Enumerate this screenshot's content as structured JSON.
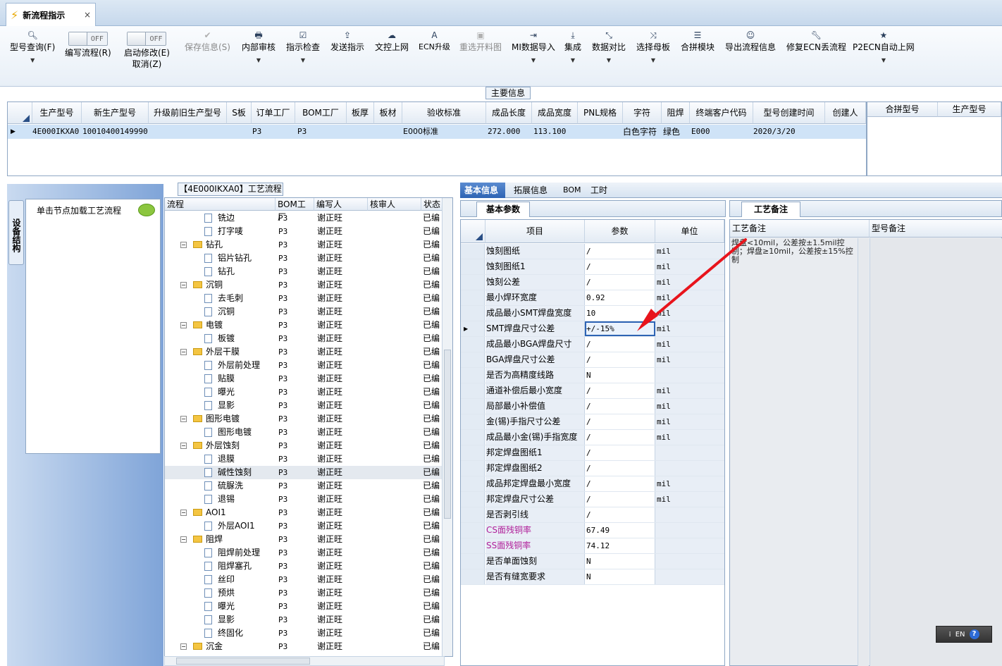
{
  "tab": {
    "title": "新流程指示",
    "close": "×"
  },
  "toolbar": {
    "query": "型号查询(F)",
    "write_flow": "编写流程(R)",
    "toggle_off": "OFF",
    "start_modify": "启动修改(E)",
    "cancel": "取消(Z)",
    "save_info": "保存信息(S)",
    "internal_review": "内部审核",
    "instruction_check": "指示检查",
    "send_instruction": "发送指示",
    "doc_online": "文控上网",
    "ecn_upgrade": "ECN升级",
    "reselect_panel": "重选开料图",
    "mi_import": "MI数据导入",
    "integrate": "集成",
    "data_compare": "数据对比",
    "select_mother": "选择母板",
    "merge_module": "合拼模块",
    "export_flow": "导出流程信息",
    "fix_ecn": "修复ECN丢流程",
    "p2ecn": "P2ECN自动上网"
  },
  "main_info": {
    "caption": "主要信息",
    "headers": [
      "生产型号",
      "新生产型号",
      "升级前旧生产型号",
      "S板",
      "订单工厂",
      "BOM工厂",
      "板厚",
      "板材",
      "验收标准",
      "成品长度",
      "成品宽度",
      "PNL规格",
      "字符",
      "阻焊",
      "终端客户代码",
      "型号创建时间",
      "创建人"
    ],
    "row": [
      "4E000IKXA0",
      "10010400149990",
      "",
      "",
      "P3",
      "P3",
      "",
      "",
      "E000标准",
      "272.000",
      "113.100",
      "",
      "白色字符",
      "绿色",
      "E000",
      "2020/3/20",
      ""
    ],
    "merge_headers": [
      "合拼型号",
      "生产型号"
    ]
  },
  "left_rail": {
    "tab": "设备结构",
    "hint": "单击节点加载工艺流程"
  },
  "process": {
    "title": "【4E000IKXA0】工艺流程",
    "headers": [
      "流程",
      "BOM工厂",
      "编写人",
      "核审人",
      "状态"
    ],
    "rows": [
      {
        "name": "铣边",
        "bom": "P3",
        "writer": "谢正旺",
        "status": "已编"
      },
      {
        "name": "打字唛",
        "bom": "P3",
        "writer": "谢正旺",
        "status": "已编"
      },
      {
        "name": "钻孔",
        "bom": "P3",
        "writer": "谢正旺",
        "status": "已编"
      },
      {
        "name": "铝片钻孔",
        "bom": "P3",
        "writer": "谢正旺",
        "status": "已编"
      },
      {
        "name": "钻孔",
        "bom": "P3",
        "writer": "谢正旺",
        "status": "已编"
      },
      {
        "name": "沉铜",
        "bom": "P3",
        "writer": "谢正旺",
        "status": "已编"
      },
      {
        "name": "去毛刺",
        "bom": "P3",
        "writer": "谢正旺",
        "status": "已编"
      },
      {
        "name": "沉铜",
        "bom": "P3",
        "writer": "谢正旺",
        "status": "已编"
      },
      {
        "name": "电镀",
        "bom": "P3",
        "writer": "谢正旺",
        "status": "已编"
      },
      {
        "name": "板镀",
        "bom": "P3",
        "writer": "谢正旺",
        "status": "已编"
      },
      {
        "name": "外层干膜",
        "bom": "P3",
        "writer": "谢正旺",
        "status": "已编"
      },
      {
        "name": "外层前处理",
        "bom": "P3",
        "writer": "谢正旺",
        "status": "已编"
      },
      {
        "name": "贴膜",
        "bom": "P3",
        "writer": "谢正旺",
        "status": "已编"
      },
      {
        "name": "曝光",
        "bom": "P3",
        "writer": "谢正旺",
        "status": "已编"
      },
      {
        "name": "显影",
        "bom": "P3",
        "writer": "谢正旺",
        "status": "已编"
      },
      {
        "name": "图形电镀",
        "bom": "P3",
        "writer": "谢正旺",
        "status": "已编"
      },
      {
        "name": "图形电镀",
        "bom": "P3",
        "writer": "谢正旺",
        "status": "已编"
      },
      {
        "name": "外层蚀刻",
        "bom": "P3",
        "writer": "谢正旺",
        "status": "已编"
      },
      {
        "name": "退膜",
        "bom": "P3",
        "writer": "谢正旺",
        "status": "已编"
      },
      {
        "name": "碱性蚀刻",
        "bom": "P3",
        "writer": "谢正旺",
        "status": "已编"
      },
      {
        "name": "硫脲洗",
        "bom": "P3",
        "writer": "谢正旺",
        "status": "已编"
      },
      {
        "name": "退锡",
        "bom": "P3",
        "writer": "谢正旺",
        "status": "已编"
      },
      {
        "name": "AOI1",
        "bom": "P3",
        "writer": "谢正旺",
        "status": "已编"
      },
      {
        "name": "外层AOI1",
        "bom": "P3",
        "writer": "谢正旺",
        "status": "已编"
      },
      {
        "name": "阻焊",
        "bom": "P3",
        "writer": "谢正旺",
        "status": "已编"
      },
      {
        "name": "阻焊前处理",
        "bom": "P3",
        "writer": "谢正旺",
        "status": "已编"
      },
      {
        "name": "阻焊塞孔",
        "bom": "P3",
        "writer": "谢正旺",
        "status": "已编"
      },
      {
        "name": "丝印",
        "bom": "P3",
        "writer": "谢正旺",
        "status": "已编"
      },
      {
        "name": "预烘",
        "bom": "P3",
        "writer": "谢正旺",
        "status": "已编"
      },
      {
        "name": "曝光",
        "bom": "P3",
        "writer": "谢正旺",
        "status": "已编"
      },
      {
        "name": "显影",
        "bom": "P3",
        "writer": "谢正旺",
        "status": "已编"
      },
      {
        "name": "终固化",
        "bom": "P3",
        "writer": "谢正旺",
        "status": "已编"
      },
      {
        "name": "沉金",
        "bom": "P3",
        "writer": "谢正旺",
        "status": "已编"
      }
    ]
  },
  "right_tabs": [
    "基本信息",
    "拓展信息",
    "BOM",
    "工时"
  ],
  "basic_params": {
    "tab": "基本参数",
    "headers": [
      "项目",
      "参数",
      "单位"
    ],
    "rows": [
      {
        "name": "蚀刻图纸",
        "value": "/",
        "unit": "mil"
      },
      {
        "name": "蚀刻图纸1",
        "value": "/",
        "unit": "mil"
      },
      {
        "name": "蚀刻公差",
        "value": "/",
        "unit": "mil"
      },
      {
        "name": "最小焊环宽度",
        "value": "0.92",
        "unit": "mil"
      },
      {
        "name": "成品最小SMT焊盘宽度",
        "value": "10",
        "unit": "mil"
      },
      {
        "name": "SMT焊盘尺寸公差",
        "value": "+/-15%",
        "unit": "mil"
      },
      {
        "name": "成品最小BGA焊盘尺寸",
        "value": "/",
        "unit": "mil"
      },
      {
        "name": "BGA焊盘尺寸公差",
        "value": "/",
        "unit": "mil"
      },
      {
        "name": "是否为高精度线路",
        "value": "N",
        "unit": ""
      },
      {
        "name": "通道补偿后最小宽度",
        "value": "/",
        "unit": "mil"
      },
      {
        "name": "局部最小补偿值",
        "value": "/",
        "unit": "mil"
      },
      {
        "name": "金(锡)手指尺寸公差",
        "value": "/",
        "unit": "mil"
      },
      {
        "name": "成品最小金(锡)手指宽度",
        "value": "/",
        "unit": "mil"
      },
      {
        "name": "邦定焊盘图纸1",
        "value": "/",
        "unit": ""
      },
      {
        "name": "邦定焊盘图纸2",
        "value": "/",
        "unit": ""
      },
      {
        "name": "成品邦定焊盘最小宽度",
        "value": "/",
        "unit": "mil"
      },
      {
        "name": "邦定焊盘尺寸公差",
        "value": "/",
        "unit": "mil"
      },
      {
        "name": "是否剥引线",
        "value": "/",
        "unit": ""
      },
      {
        "name": "CS面残铜率",
        "value": "67.49",
        "unit": ""
      },
      {
        "name": "SS面残铜率",
        "value": "74.12",
        "unit": ""
      },
      {
        "name": "是否单面蚀刻",
        "value": "N",
        "unit": ""
      },
      {
        "name": "是否有缝宽要求",
        "value": "N",
        "unit": ""
      }
    ]
  },
  "remarks": {
    "tab": "工艺备注",
    "col1": "工艺备注",
    "col2": "型号备注",
    "text": "焊盘<10mil，公差按±1.5mil控制；焊盘≥10mil，公差按±15%控制"
  },
  "lang": "EN",
  "colors": {
    "accent": "#2e64b4",
    "selection": "#cfe3f7",
    "arrow": "#e8141c",
    "pink_label": "#b0209a"
  }
}
